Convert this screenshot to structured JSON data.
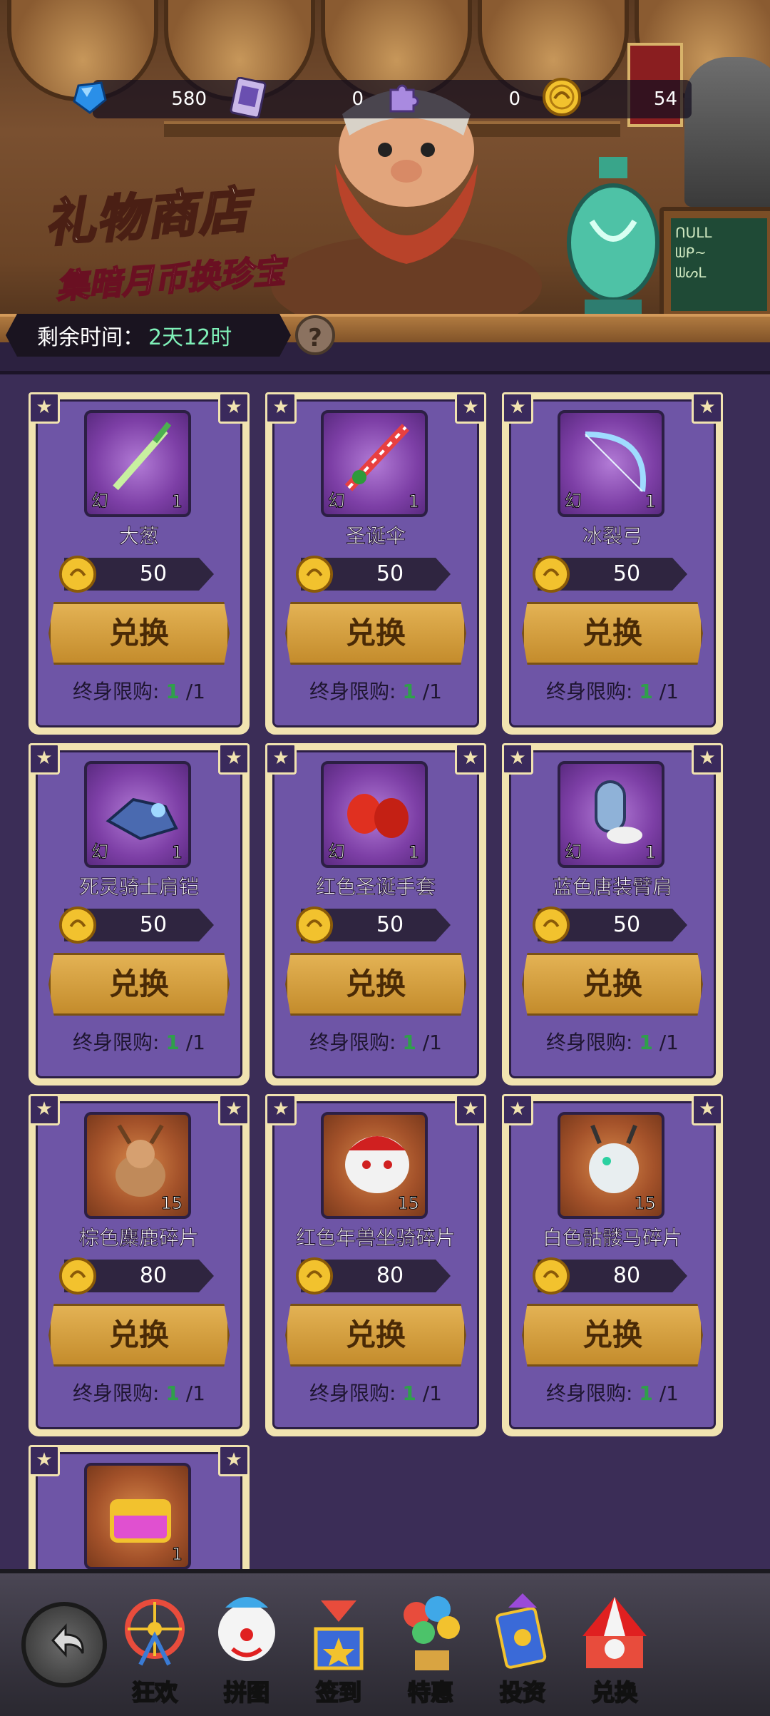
{
  "header": {
    "title": "礼物商店",
    "subtitle": "集暗月币换珍宝",
    "timer_label": "剩余时间：",
    "timer_value": "2天12时",
    "help_label": "?"
  },
  "resources": [
    {
      "icon": "blue-gem-icon",
      "value": "580"
    },
    {
      "icon": "ticket-icon",
      "value": "0"
    },
    {
      "icon": "puzzle-piece-icon",
      "value": "0"
    },
    {
      "icon": "dark-moon-coin-icon",
      "value": "54"
    }
  ],
  "shop": {
    "items": [
      {
        "name": "大葱",
        "badge": "幻",
        "qty": "1",
        "price": "50",
        "button": "兑换",
        "limit_label": "终身限购:",
        "limit_used": "1",
        "limit_total": "/1",
        "frame": "purple",
        "icon": "green-onion-icon"
      },
      {
        "name": "圣诞伞",
        "badge": "幻",
        "qty": "1",
        "price": "50",
        "button": "兑换",
        "limit_label": "终身限购:",
        "limit_used": "1",
        "limit_total": "/1",
        "frame": "purple",
        "icon": "christmas-umbrella-icon"
      },
      {
        "name": "冰裂弓",
        "badge": "幻",
        "qty": "1",
        "price": "50",
        "button": "兑换",
        "limit_label": "终身限购:",
        "limit_used": "1",
        "limit_total": "/1",
        "frame": "purple",
        "icon": "ice-bow-icon"
      },
      {
        "name": "死灵骑士肩铠",
        "badge": "幻",
        "qty": "1",
        "price": "50",
        "button": "兑换",
        "limit_label": "终身限购:",
        "limit_used": "1",
        "limit_total": "/1",
        "frame": "purple",
        "icon": "shoulder-armor-icon"
      },
      {
        "name": "红色圣诞手套",
        "badge": "幻",
        "qty": "1",
        "price": "50",
        "button": "兑换",
        "limit_label": "终身限购:",
        "limit_used": "1",
        "limit_total": "/1",
        "frame": "purple",
        "icon": "red-gloves-icon"
      },
      {
        "name": "蓝色唐装臂肩",
        "badge": "幻",
        "qty": "1",
        "price": "50",
        "button": "兑换",
        "limit_label": "终身限购:",
        "limit_used": "1",
        "limit_total": "/1",
        "frame": "purple",
        "icon": "blue-arm-guard-icon"
      },
      {
        "name": "棕色麋鹿碎片",
        "badge": "",
        "qty": "15",
        "price": "80",
        "button": "兑换",
        "limit_label": "终身限购:",
        "limit_used": "1",
        "limit_total": "/1",
        "frame": "orange",
        "icon": "reindeer-mount-icon"
      },
      {
        "name": "红色年兽坐骑碎片",
        "badge": "",
        "qty": "15",
        "price": "80",
        "button": "兑换",
        "limit_label": "终身限购:",
        "limit_used": "1",
        "limit_total": "/1",
        "frame": "orange",
        "icon": "nian-beast-mount-icon"
      },
      {
        "name": "白色骷髅马碎片",
        "badge": "",
        "qty": "15",
        "price": "80",
        "button": "兑换",
        "limit_label": "终身限购:",
        "limit_used": "1",
        "limit_total": "/1",
        "frame": "orange",
        "icon": "skeleton-horse-icon"
      },
      {
        "name": "",
        "badge": "",
        "qty": "1",
        "price": "",
        "button": "",
        "limit_label": "",
        "limit_used": "",
        "limit_total": "",
        "frame": "orange",
        "icon": "treasure-chest-icon"
      }
    ]
  },
  "nav": {
    "back_icon": "back-arrow-icon",
    "items": [
      {
        "label": "狂欢",
        "icon": "ferris-wheel-icon"
      },
      {
        "label": "拼图",
        "icon": "clown-face-icon"
      },
      {
        "label": "签到",
        "icon": "jack-in-the-box-icon"
      },
      {
        "label": "特惠",
        "icon": "balloons-icon"
      },
      {
        "label": "投资",
        "icon": "magic-cards-icon"
      },
      {
        "label": "兑换",
        "icon": "circus-tent-icon"
      }
    ]
  },
  "colors": {
    "card_frame": "#f1e3b0",
    "card_bg": "#6e55a6",
    "button": "#d9a441",
    "timer_value": "#7ff0b8",
    "limit_count": "#2fa04a"
  }
}
